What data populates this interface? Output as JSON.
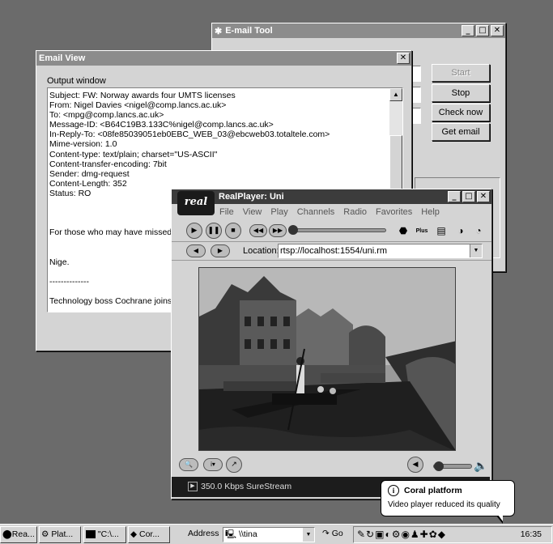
{
  "email_tool": {
    "title": "E-mail Tool",
    "buttons": {
      "start": "Start",
      "stop": "Stop",
      "check_now": "Check now",
      "get_email": "Get email"
    }
  },
  "email_view": {
    "title": "Email View",
    "output_label": "Output window",
    "lines": [
      "Subject: FW: Norway awards four UMTS licenses",
      "From: Nigel Davies <nigel@comp.lancs.ac.uk>",
      "To: <mpg@comp.lancs.ac.uk>",
      "Message-ID: <B64C19B3.133C%nigel@comp.lancs.ac.uk>",
      "In-Reply-To: <08fe85039051eb0EBC_WEB_03@ebcweb03.totaltele.com>",
      "Mime-version: 1.0",
      "Content-type: text/plain; charset=\"US-ASCII\"",
      "Content-transfer-encoding: 7bit",
      "Sender: dmg-request",
      "Content-Length: 352",
      "Status: RO",
      "",
      "",
      "",
      "For those who may have missed it",
      "",
      "",
      "Nige.",
      "",
      "--------------",
      "",
      "Technology boss Cochrane joins"
    ]
  },
  "realplayer": {
    "logo": "real",
    "title": "RealPlayer: Uni",
    "menu": [
      "File",
      "View",
      "Play",
      "Channels",
      "Radio",
      "Favorites",
      "Help"
    ],
    "location_label": "Location:",
    "location_value": "rtsp://localhost:1554/uni.rm",
    "plus_label": "Plus",
    "status": "350.0 Kbps SureStream"
  },
  "taskbar": {
    "tasks": [
      "Rea...",
      "Plat...",
      "\"C:\\...",
      "Cor..."
    ],
    "address_label": "Address",
    "address_value": "\\\\tina",
    "go_label": "Go",
    "clock": "16:35"
  },
  "balloon": {
    "title": "Coral platform",
    "message": "Video player reduced its quality"
  }
}
